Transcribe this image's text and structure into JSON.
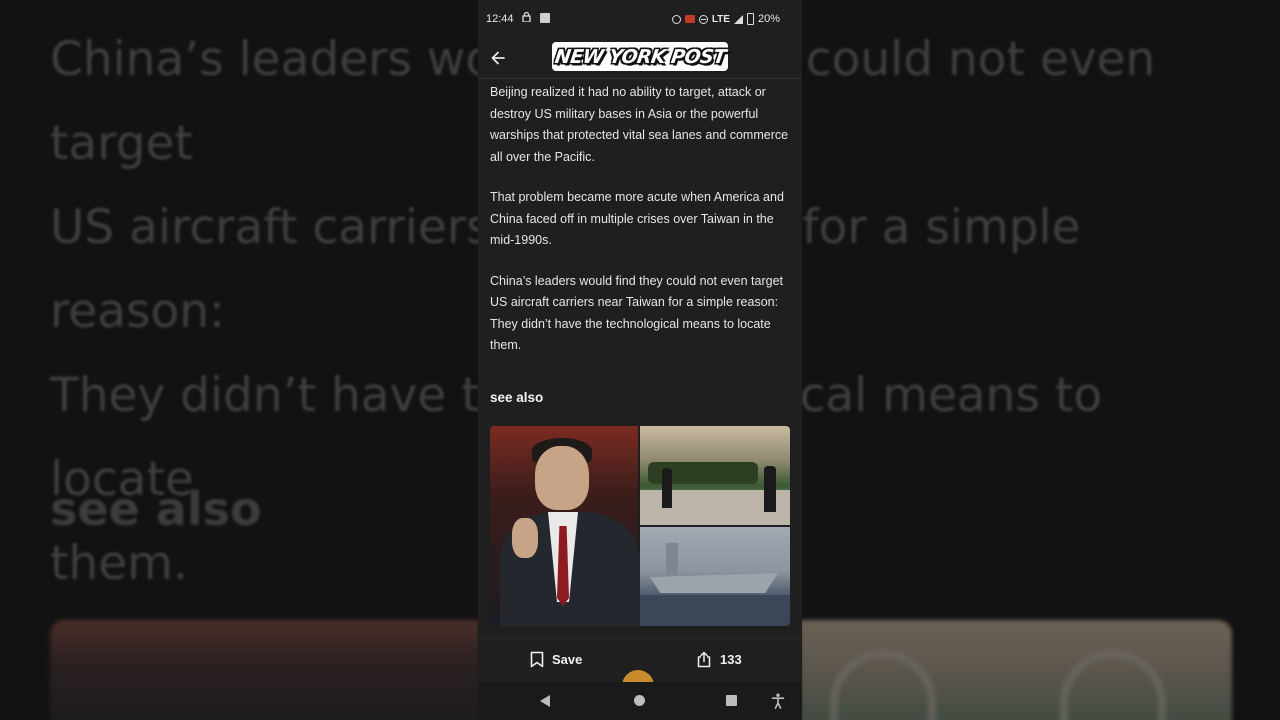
{
  "background_blur": {
    "lines": [
      "China’s leaders would find they could not even target",
      "US aircraft carriers near Taiwan for a simple reason:",
      "They didn’t have the technological means to locate",
      "them."
    ],
    "see_also": "see also"
  },
  "status_bar": {
    "time": "12:44",
    "network": "LTE",
    "battery": "20%"
  },
  "app_bar": {
    "logo": "NEW YORK POST"
  },
  "article": {
    "paragraphs": [
      "Beijing realized it had no ability to target, attack or destroy US military bases in Asia or the powerful warships that protected vital sea lanes and commerce all over the Pacific.",
      "That problem became more acute when America and China faced off in multiple crises over Taiwan in the mid-1990s.",
      "China’s leaders would find they could not even target US aircraft carriers near Taiwan for a simple reason: They didn’t have the technological means to locate them."
    ],
    "see_also": "see also"
  },
  "actions": {
    "save_label": "Save",
    "share_count": "133"
  },
  "colors": {
    "phone_bg": "#1f1f1f",
    "text": "#e6e6e6",
    "fab": "#c98a2b"
  }
}
